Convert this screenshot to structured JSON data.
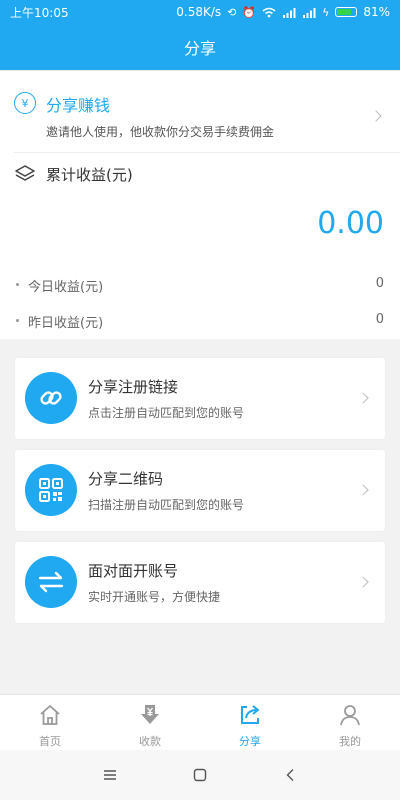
{
  "status_bar": {
    "time": "上午10:05",
    "speed": "0.58K/s",
    "battery": "81%",
    "icons": [
      "sync-off-icon",
      "alarm-icon",
      "wifi-icon",
      "signal-icon",
      "signal-icon",
      "charging-icon",
      "battery-icon"
    ]
  },
  "header": {
    "title": "分享"
  },
  "earn": {
    "title": "分享赚钱",
    "description": "邀请他人使用，他收款你分交易手续费佣金",
    "icon": "money-bag-icon"
  },
  "earnings": {
    "label": "累计收益(元)",
    "total": "0.00",
    "today_label": "今日收益(元)",
    "today_value": "0",
    "yesterday_label": "昨日收益(元)",
    "yesterday_value": "0",
    "icon": "layers-icon"
  },
  "share_options": [
    {
      "title": "分享注册链接",
      "description": "点击注册自动匹配到您的账号",
      "icon": "link-icon"
    },
    {
      "title": "分享二维码",
      "description": "扫描注册自动匹配到您的账号",
      "icon": "qr-code-icon"
    },
    {
      "title": "面对面开账号",
      "description": "实时开通账号，方便快捷",
      "icon": "swap-icon"
    }
  ],
  "tabs": [
    {
      "label": "首页",
      "icon": "home-icon",
      "active": false
    },
    {
      "label": "收款",
      "icon": "receive-money-icon",
      "active": false
    },
    {
      "label": "分享",
      "icon": "share-icon",
      "active": true
    },
    {
      "label": "我的",
      "icon": "person-icon",
      "active": false
    }
  ],
  "system_nav": {
    "icons": [
      "menu-icon",
      "home-square-icon",
      "back-icon"
    ]
  },
  "colors": {
    "accent": "#20a9f0",
    "background": "#f2f2f2",
    "card": "#ffffff",
    "battery_fill": "#35d24b"
  }
}
